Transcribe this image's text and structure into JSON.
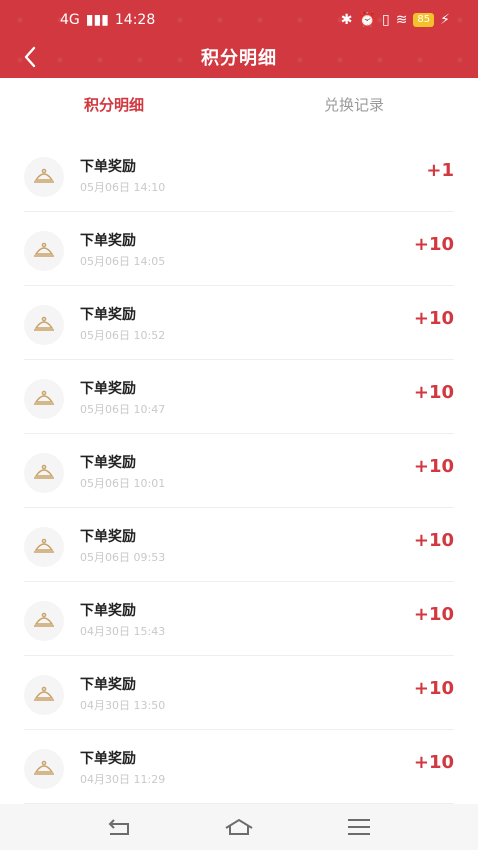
{
  "status_bar": {
    "network": "4G",
    "time": "14:28",
    "battery": "85"
  },
  "header": {
    "title": "积分明细"
  },
  "tabs": [
    {
      "label": "积分明细",
      "active": true
    },
    {
      "label": "兑换记录",
      "active": false
    }
  ],
  "records": [
    {
      "label": "下单奖励",
      "time": "05月06日 14:10",
      "points": "+1"
    },
    {
      "label": "下单奖励",
      "time": "05月06日 14:05",
      "points": "+10"
    },
    {
      "label": "下单奖励",
      "time": "05月06日 10:52",
      "points": "+10"
    },
    {
      "label": "下单奖励",
      "time": "05月06日 10:47",
      "points": "+10"
    },
    {
      "label": "下单奖励",
      "time": "05月06日 10:01",
      "points": "+10"
    },
    {
      "label": "下单奖励",
      "time": "05月06日 09:53",
      "points": "+10"
    },
    {
      "label": "下单奖励",
      "time": "04月30日 15:43",
      "points": "+10"
    },
    {
      "label": "下单奖励",
      "time": "04月30日 13:50",
      "points": "+10"
    },
    {
      "label": "下单奖励",
      "time": "04月30日 11:29",
      "points": "+10"
    }
  ],
  "colors": {
    "accent": "#d2383f",
    "icon": "#c9a36a"
  }
}
